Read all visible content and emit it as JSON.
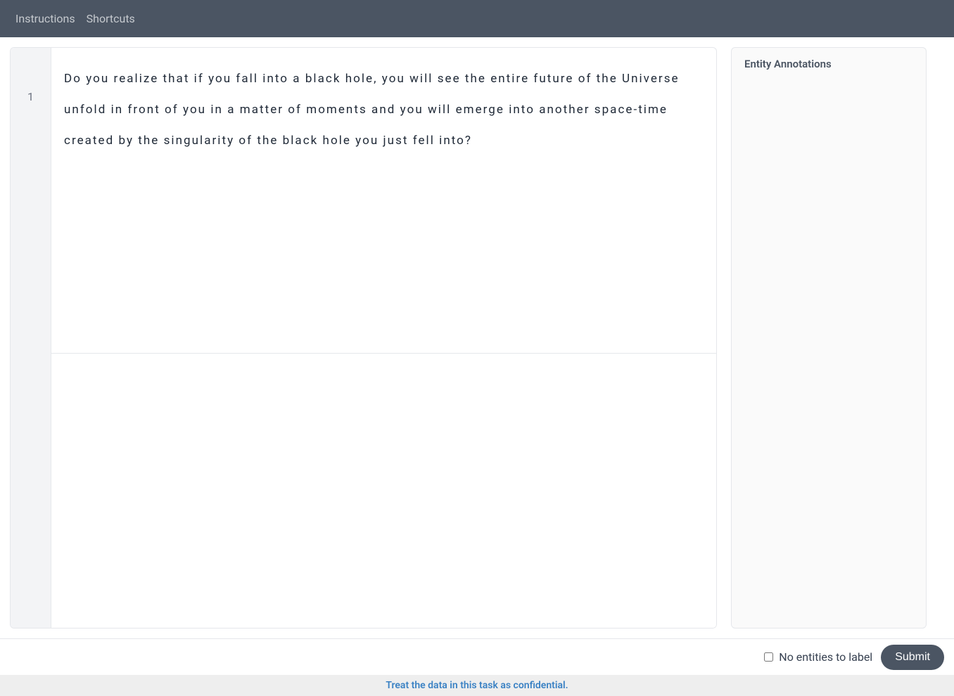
{
  "topbar": {
    "instructions": "Instructions",
    "shortcuts": "Shortcuts"
  },
  "content": {
    "line_number": "1",
    "text": "Do you realize that if you fall into a black hole, you will see the entire future of the Universe unfold in front of you in a matter of moments and you will emerge into another space-time created by the singularity of the black hole you just fell into?"
  },
  "sidebar": {
    "title": "Entity Annotations"
  },
  "footer": {
    "no_entities_label": "No entities to label",
    "submit_label": "Submit"
  },
  "confidential": {
    "text": "Treat the data in this task as confidential."
  }
}
